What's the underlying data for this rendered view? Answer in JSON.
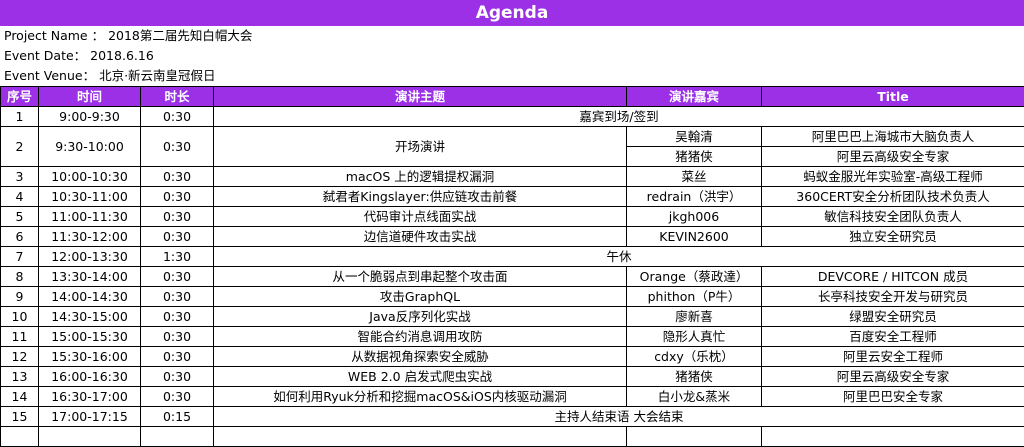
{
  "title": "Agenda",
  "meta": {
    "project_label": "Project Name ：",
    "project_value": "2018第二届先知白帽大会",
    "date_label": "Event Date：",
    "date_value": "2018.6.16",
    "venue_label": "Event Venue：",
    "venue_value": "北京·新云南皇冠假日"
  },
  "headers": [
    "序号",
    "时间",
    "时长",
    "演讲主题",
    "演讲嘉宾",
    "Title"
  ],
  "rows": [
    {
      "no": "1",
      "time": "9:00-9:30",
      "dur": "0:30",
      "span": "嘉宾到场/签到"
    },
    {
      "no": "2",
      "time": "9:30-10:00",
      "dur": "0:30",
      "topic": "开场演讲",
      "speakers": [
        {
          "speaker": "吴翰清",
          "title": "阿里巴巴上海城市大脑负责人"
        },
        {
          "speaker": "猪猪侠",
          "title": "阿里云高级安全专家"
        }
      ]
    },
    {
      "no": "3",
      "time": "10:00-10:30",
      "dur": "0:30",
      "topic": "macOS 上的逻辑提权漏洞",
      "speaker": "菜丝",
      "title": "蚂蚁金服光年实验室-高级工程师"
    },
    {
      "no": "4",
      "time": "10:30-11:00",
      "dur": "0:30",
      "topic": "弑君者Kingslayer:供应链攻击前餐",
      "speaker": "redrain（洪宇）",
      "title": "360CERT安全分析团队技术负责人"
    },
    {
      "no": "5",
      "time": "11:00-11:30",
      "dur": "0:30",
      "topic": "代码审计点线面实战",
      "speaker": "jkgh006",
      "title": "敏信科技安全团队负责人"
    },
    {
      "no": "6",
      "time": "11:30-12:00",
      "dur": "0:30",
      "topic": "边信道硬件攻击实战",
      "speaker": "KEVIN2600",
      "title": "独立安全研究员"
    },
    {
      "no": "7",
      "time": "12:00-13:30",
      "dur": "1:30",
      "span": "午休"
    },
    {
      "no": "8",
      "time": "13:30-14:00",
      "dur": "0:30",
      "topic": "从一个脆弱点到串起整个攻击面",
      "speaker": "Orange（蔡政達）",
      "title": "DEVCORE / HITCON 成员"
    },
    {
      "no": "9",
      "time": "14:00-14:30",
      "dur": "0:30",
      "topic": "攻击GraphQL",
      "speaker": "phithon（P牛）",
      "title": "长亭科技安全开发与研究员"
    },
    {
      "no": "10",
      "time": "14:30-15:00",
      "dur": "0:30",
      "topic": "Java反序列化实战",
      "speaker": "廖新喜",
      "title": "绿盟安全研究员"
    },
    {
      "no": "11",
      "time": "15:00-15:30",
      "dur": "0:30",
      "topic": "智能合约消息调用攻防",
      "speaker": "隐形人真忙",
      "title": "百度安全工程师"
    },
    {
      "no": "12",
      "time": "15:30-16:00",
      "dur": "0:30",
      "topic": "从数据视角探索安全威胁",
      "speaker": "cdxy（乐枕）",
      "title": "阿里云安全工程师"
    },
    {
      "no": "13",
      "time": "16:00-16:30",
      "dur": "0:30",
      "topic": "WEB 2.0 启发式爬虫实战",
      "speaker": "猪猪侠",
      "title": "阿里云高级安全专家"
    },
    {
      "no": "14",
      "time": "16:30-17:00",
      "dur": "0:30",
      "topic": "如何利用Ryuk分析和挖掘macOS&iOS内核驱动漏洞",
      "speaker": "白小龙&蒸米",
      "title": "阿里巴巴安全专家"
    },
    {
      "no": "15",
      "time": "17:00-17:15",
      "dur": "0:15",
      "span": "主持人结束语 大会结束"
    }
  ]
}
